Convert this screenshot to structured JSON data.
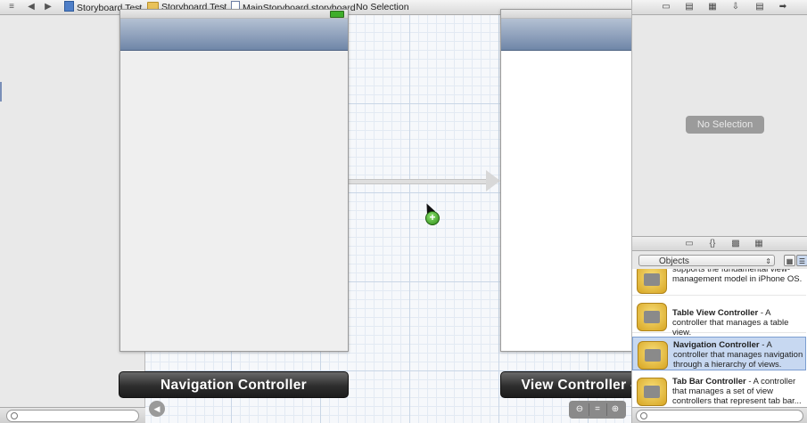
{
  "jump_bar": {
    "crumbs": [
      {
        "label": "Storyboard Test",
        "icon": "project-icon"
      },
      {
        "label": "Storyboard Test",
        "icon": "folder-icon"
      },
      {
        "label": "MainStoryboard.storyboard",
        "icon": "storyboard-icon"
      },
      {
        "label": "No Selection",
        "icon": ""
      }
    ]
  },
  "scenes": {
    "navigation_controller_label": "Navigation Controller",
    "root_view_label": "View Controller - Root View"
  },
  "utilities": {
    "inspector_placeholder": "No Selection",
    "library_filter": "Objects",
    "items": [
      {
        "title": "",
        "desc": "supports the fundamental view-management model in iPhone OS."
      },
      {
        "title": "Table View Controller",
        "desc": " - A controller that manages a table view."
      },
      {
        "title": "Navigation Controller",
        "desc": " - A controller that manages navigation through a hierarchy of views."
      },
      {
        "title": "Tab Bar Controller",
        "desc": " - A controller that manages a set of view controllers that represent tab bar..."
      }
    ]
  }
}
